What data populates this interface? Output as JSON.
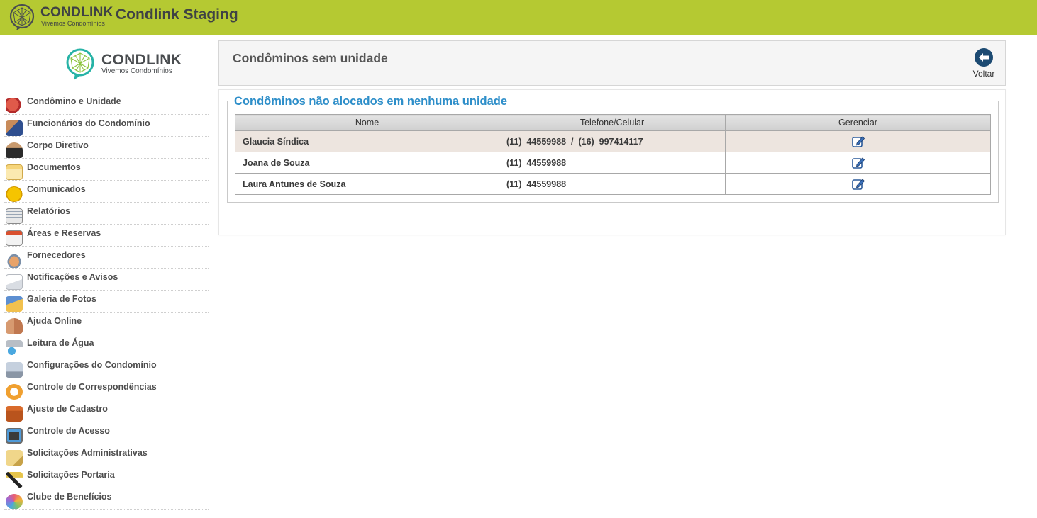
{
  "topbar": {
    "brand": "CONDLINK",
    "tagline": "Vivemos Condomínios",
    "app_title": "Condlink Staging",
    "color": "#b5c932"
  },
  "sidebar": {
    "brand": "CONDLINK",
    "tagline": "Vivemos Condomínios",
    "items": [
      {
        "label": "Condômino e Unidade",
        "icon": "house-person-icon"
      },
      {
        "label": "Funcionários do Condomínio",
        "icon": "employees-icon"
      },
      {
        "label": "Corpo Diretivo",
        "icon": "director-icon"
      },
      {
        "label": "Documentos",
        "icon": "documents-icon"
      },
      {
        "label": "Comunicados",
        "icon": "alert-icon"
      },
      {
        "label": "Relatórios",
        "icon": "report-icon"
      },
      {
        "label": "Áreas e Reservas",
        "icon": "calendar-icon"
      },
      {
        "label": "Fornecedores",
        "icon": "handshake-icon"
      },
      {
        "label": "Notificações e Avisos",
        "icon": "envelope-icon"
      },
      {
        "label": "Galeria de Fotos",
        "icon": "photo-folder-icon"
      },
      {
        "label": "Ajuda Online",
        "icon": "support-icon"
      },
      {
        "label": "Leitura de Água",
        "icon": "water-tap-icon"
      },
      {
        "label": "Configurações do Condomínio",
        "icon": "building-settings-icon"
      },
      {
        "label": "Controle de Correspondências",
        "icon": "mail-icon"
      },
      {
        "label": "Ajuste de Cadastro",
        "icon": "briefcase-icon"
      },
      {
        "label": "Controle de Acesso",
        "icon": "access-control-icon"
      },
      {
        "label": "Solicitações Administrativas",
        "icon": "request-icon"
      },
      {
        "label": "Solicitações Portaria",
        "icon": "gate-icon"
      },
      {
        "label": "Clube de Benefícios",
        "icon": "benefits-icon"
      }
    ]
  },
  "page": {
    "title": "Condôminos sem unidade",
    "back_label": "Voltar"
  },
  "section": {
    "legend": "Condôminos não alocados em nenhuma unidade",
    "columns": [
      "Nome",
      "Telefone/Celular",
      "Gerenciar"
    ],
    "rows": [
      {
        "name": "Glaucia Síndica",
        "phone": "(11)  44559988  /  (16)  997414117",
        "selected": true
      },
      {
        "name": "Joana de Souza",
        "phone": "(11)  44559988",
        "selected": false
      },
      {
        "name": "Laura Antunes de Souza",
        "phone": "(11)  44559988",
        "selected": false
      }
    ]
  },
  "colors": {
    "accent_blue": "#2d8ec9",
    "selected_row": "#ede5df",
    "back_button": "#1c4a72"
  }
}
